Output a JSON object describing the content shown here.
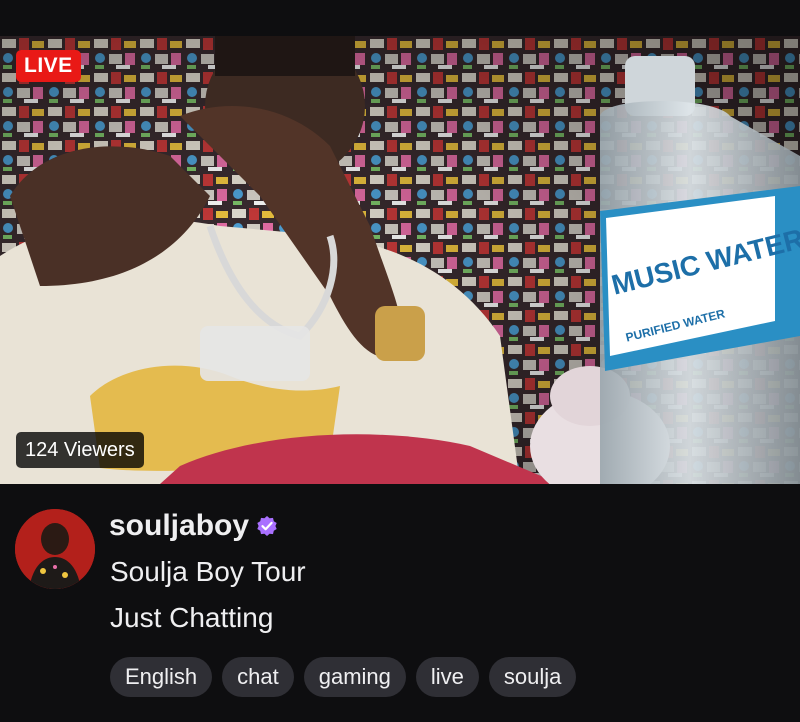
{
  "stream": {
    "live_label": "LIVE",
    "viewers_label": "124 Viewers",
    "bottle_brand": "MUSIC WATER",
    "bottle_subtitle": "PURIFIED WATER"
  },
  "channel": {
    "name": "souljaboy",
    "title": "Soulja Boy Tour",
    "category": "Just Chatting",
    "verified": true,
    "verified_color": "#a970ff"
  },
  "tags": [
    {
      "label": "English"
    },
    {
      "label": "chat"
    },
    {
      "label": "gaming"
    },
    {
      "label": "live"
    },
    {
      "label": "soulja"
    }
  ],
  "colors": {
    "background": "#0e0e10",
    "live_red": "#e91916",
    "tag_bg": "#2f2f35",
    "text": "#efeff1"
  }
}
